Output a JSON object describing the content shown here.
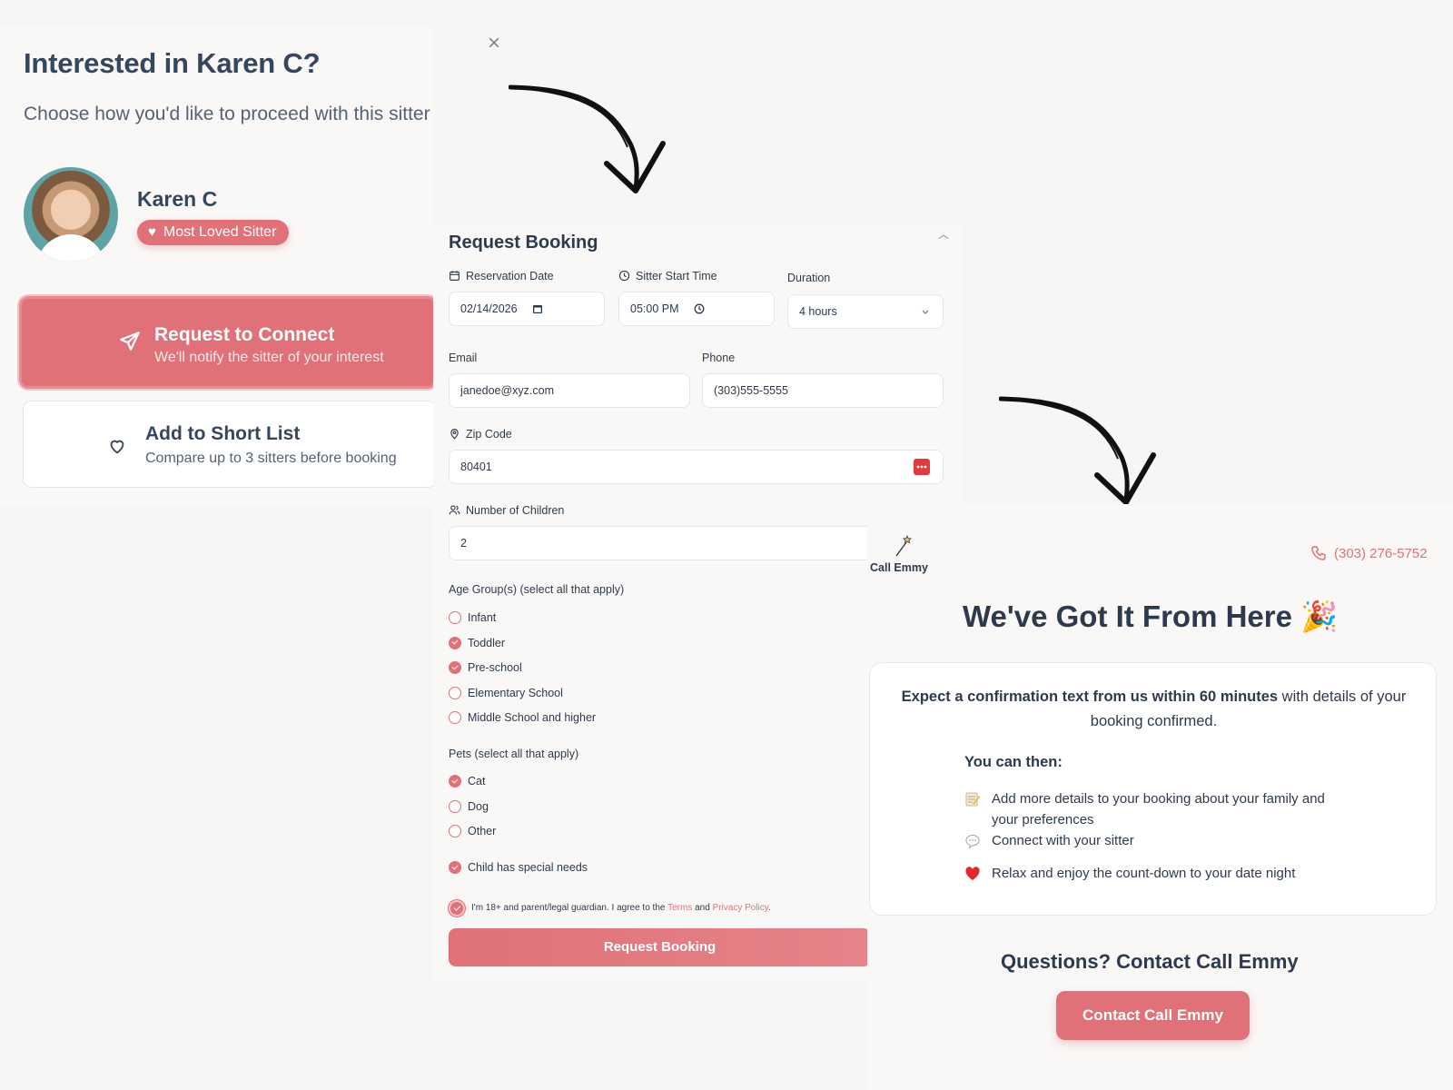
{
  "modal": {
    "title": "Interested in Karen C?",
    "subtitle": "Choose how you'd like to proceed with this sitter",
    "sitter_name": "Karen C",
    "badge": "Most Loved Sitter",
    "connect_title": "Request to Connect",
    "connect_sub": "We'll notify the sitter of your interest",
    "shortlist_title": "Add to Short List",
    "shortlist_sub": "Compare up to 3 sitters before booking"
  },
  "booking": {
    "title": "Request Booking",
    "date_label": "Reservation Date",
    "date_value": "02/14/2026",
    "time_label": "Sitter Start Time",
    "time_value": "05:00 PM",
    "duration_label": "Duration",
    "duration_value": "4 hours",
    "email_label": "Email",
    "email_value": "janedoe@xyz.com",
    "phone_label": "Phone",
    "phone_value": "(303)555-5555",
    "zip_label": "Zip Code",
    "zip_value": "80401",
    "children_label": "Number of Children",
    "children_value": "2",
    "age_label": "Age Group(s) (select all that apply)",
    "age_options": [
      {
        "label": "Infant",
        "checked": false
      },
      {
        "label": "Toddler",
        "checked": true
      },
      {
        "label": "Pre-school",
        "checked": true
      },
      {
        "label": "Elementary School",
        "checked": false
      },
      {
        "label": "Middle School and higher",
        "checked": false
      }
    ],
    "pets_label": "Pets (select all that apply)",
    "pet_options": [
      {
        "label": "Cat",
        "checked": true
      },
      {
        "label": "Dog",
        "checked": false
      },
      {
        "label": "Other",
        "checked": false
      }
    ],
    "special_needs": "Child has special needs",
    "terms_prefix": "I'm 18+ and parent/legal guardian. I agree to the",
    "terms_link": "Terms",
    "terms_and": "and",
    "privacy_link": "Privacy Policy",
    "terms_suffix": ".",
    "submit": "Request Booking"
  },
  "confirm": {
    "brand": "Call Emmy",
    "phone": "(303) 276-5752",
    "title": "We've Got It From Here 🎉",
    "lead_bold": "Expect a confirmation text from us within 60 minutes",
    "lead_rest": " with details of your booking confirmed.",
    "then": "You can then:",
    "items": [
      "Add more details to your booking about your family and your preferences",
      "Connect with your sitter",
      "Relax and enjoy the count-down to your date night"
    ],
    "questions": "Questions? Contact Call Emmy",
    "contact_button": "Contact Call Emmy"
  },
  "colors": {
    "accent": "#e07178",
    "text": "#2d3a4d",
    "background": "#f7f6f5"
  }
}
